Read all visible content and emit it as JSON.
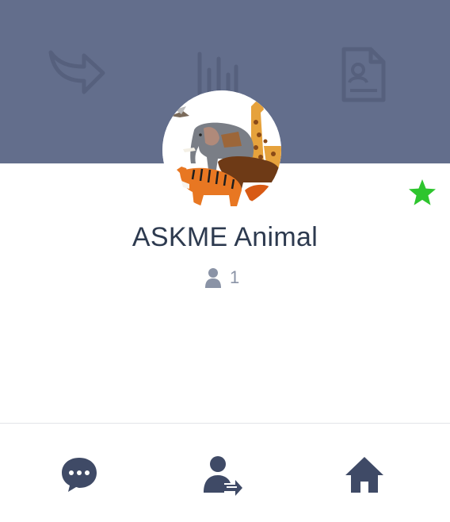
{
  "profile": {
    "name": "ASKME Animal",
    "member_count": "1",
    "avatar_icon": "animals-group-illustration"
  },
  "header": {
    "background_color": "#636e8c",
    "decorative_icons": [
      "share-arrow-icon",
      "bar-chart-icon",
      "document-icon"
    ]
  },
  "favorite": {
    "icon": "star-icon",
    "color": "#2ec52e",
    "active": true
  },
  "actions": [
    {
      "icon": "chat-bubble-icon"
    },
    {
      "icon": "add-friend-icon"
    },
    {
      "icon": "home-icon"
    }
  ],
  "colors": {
    "icon_dark": "#3f4a66",
    "text": "#2d3a4f",
    "muted": "#8a93a6"
  }
}
